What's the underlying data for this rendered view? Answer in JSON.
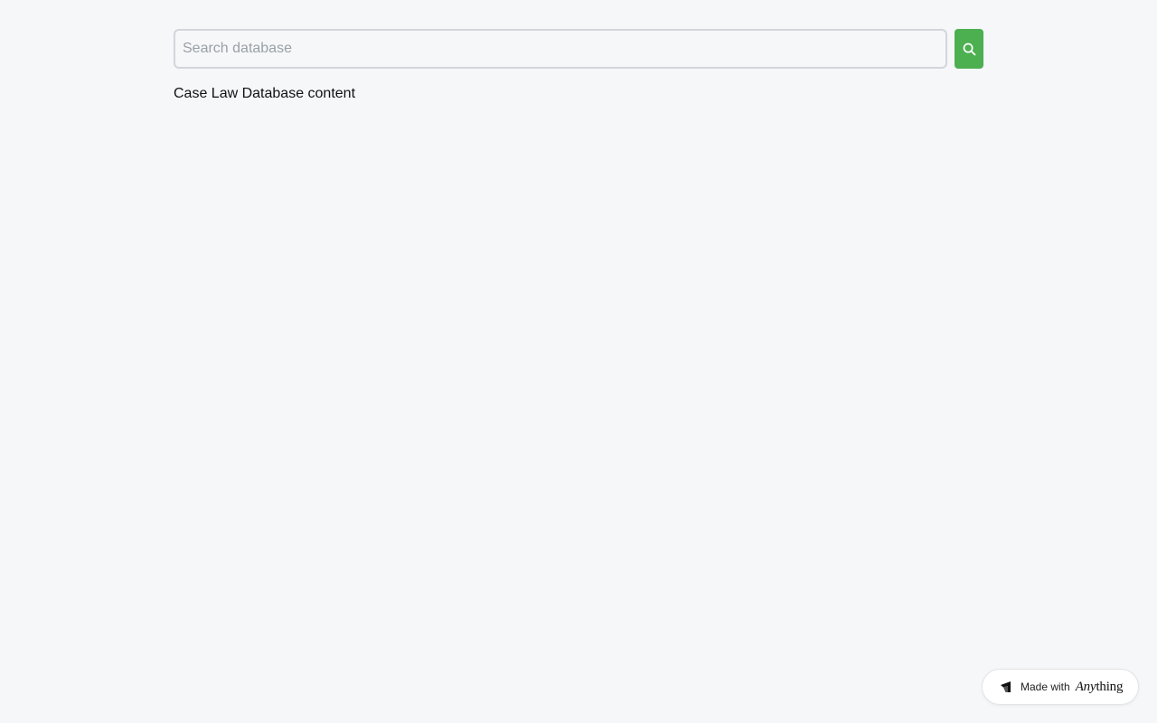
{
  "search": {
    "placeholder": "Search database",
    "value": "",
    "button_icon": "search-icon",
    "button_color": "#4caf50"
  },
  "main": {
    "content_text": "Case Law Database content"
  },
  "badge": {
    "logo_icon": "anything-logo-icon",
    "prefix": "Made with",
    "brand_italic": "Any",
    "brand_rest": "thing"
  }
}
